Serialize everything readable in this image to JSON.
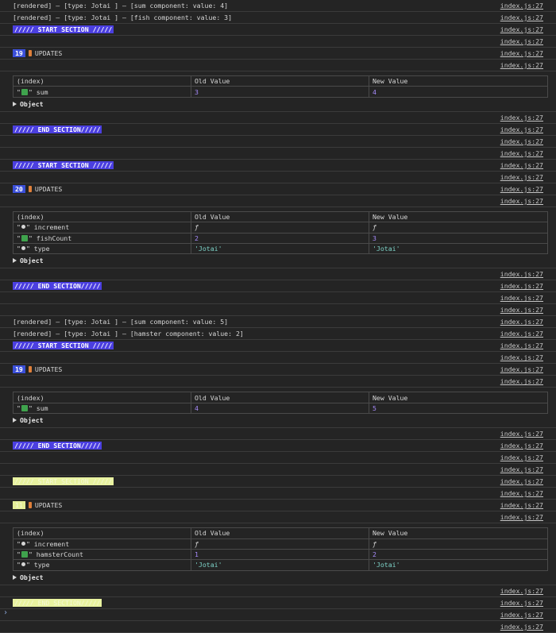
{
  "source_link": "index.js:27",
  "colors": {
    "banner_blue": "#4b3fe0",
    "badge_blue": "#3b4fd8",
    "banner_yellow": "#e8f2a0",
    "badge_yellow": "#e4ee98"
  },
  "icons": {
    "update_emoji": "mushroom-icon",
    "changed_marker": "check-icon",
    "unchanged_marker": "dot-icon",
    "expand": "triangle-right-icon"
  },
  "texts": {
    "rendered_sum_4": "[rendered] — [type: Jotai ] — [sum component: value: 4]",
    "rendered_fish_3": "[rendered] — [type: Jotai ] — [fish component: value: 3]",
    "rendered_sum_5": "[rendered] — [type: Jotai ] — [sum component: value: 5]",
    "rendered_hamster_2": "[rendered] — [type: Jotai ] — [hamster component: value: 2]",
    "start_section": "///// START SECTION /////",
    "end_section": "///// END SECTION/////",
    "updates": "UPDATES",
    "object": "Object",
    "col_index": "(index)",
    "col_old": "Old Value",
    "col_new": "New Value"
  },
  "blocks": [
    {
      "count": "19",
      "rows": [
        {
          "marker": "check",
          "key": "sum",
          "old": "3",
          "old_type": "num",
          "new": "4",
          "new_type": "num"
        }
      ]
    },
    {
      "count": "20",
      "rows": [
        {
          "marker": "dot",
          "key": "increment",
          "old": "ƒ",
          "old_type": "fn",
          "new": "ƒ",
          "new_type": "fn"
        },
        {
          "marker": "check",
          "key": "fishCount",
          "old": "2",
          "old_type": "num",
          "new": "3",
          "new_type": "num"
        },
        {
          "marker": "dot",
          "key": "type",
          "old": "'Jotai'",
          "old_type": "str",
          "new": "'Jotai'",
          "new_type": "str"
        }
      ]
    },
    {
      "count": "19",
      "rows": [
        {
          "marker": "check",
          "key": "sum",
          "old": "4",
          "old_type": "num",
          "new": "5",
          "new_type": "num"
        }
      ]
    },
    {
      "count": "11",
      "rows": [
        {
          "marker": "dot",
          "key": "increment",
          "old": "ƒ",
          "old_type": "fn",
          "new": "ƒ",
          "new_type": "fn"
        },
        {
          "marker": "check",
          "key": "hamsterCount",
          "old": "1",
          "old_type": "num",
          "new": "2",
          "new_type": "num"
        },
        {
          "marker": "dot",
          "key": "type",
          "old": "'Jotai'",
          "old_type": "str",
          "new": "'Jotai'",
          "new_type": "str"
        }
      ]
    }
  ],
  "prompt_symbol": "›"
}
